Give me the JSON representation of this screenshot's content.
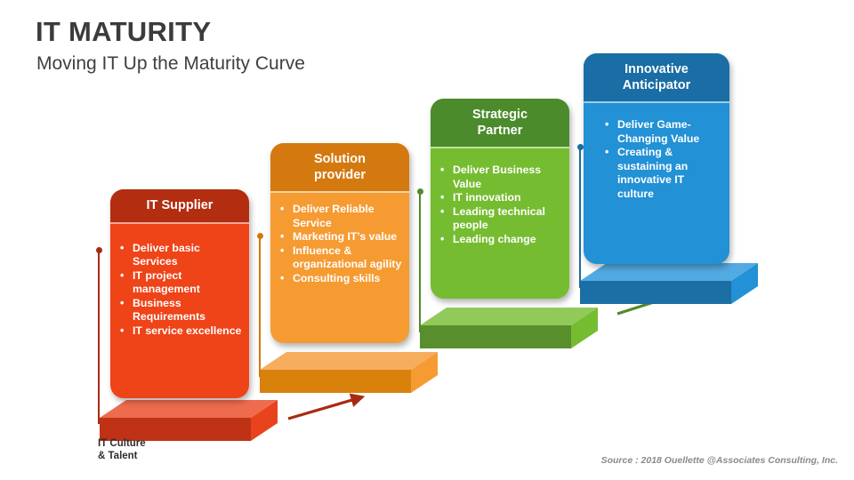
{
  "header": {
    "title": "IT MATURITY",
    "subtitle": "Moving IT Up the Maturity Curve"
  },
  "footer": {
    "source": "Source : 2018 Ouellette @Associates Consulting, Inc."
  },
  "base": {
    "label": "IT Culture\n& Talent"
  },
  "colors": {
    "title_text": "#3b3b3b",
    "source_text": "#8a8a8a",
    "red_header": "#b32d11",
    "red_body": "#ef4318",
    "red_slab_top": "#ef6b4e",
    "red_slab_front": "#bf3216",
    "red_slab_side": "#e8431d",
    "red_stem": "#a82a12",
    "orange_header": "#d4790f",
    "orange_body": "#f59b32",
    "orange_slab_top": "#f7ad5e",
    "orange_slab_front": "#d8820c",
    "orange_slab_side": "#f59b32",
    "orange_stem": "#cf7910",
    "green_header": "#4b8b2b",
    "green_body": "#76bc31",
    "green_slab_top": "#92c95b",
    "green_slab_front": "#588f2c",
    "green_slab_side": "#76bc31",
    "green_stem": "#4e8b2c",
    "blue_header": "#1a6ea5",
    "blue_body": "#2291d6",
    "blue_slab_top": "#52aae2",
    "blue_slab_front": "#1c6fa5",
    "blue_slab_side": "#2291d6",
    "blue_stem": "#1d6ea3"
  },
  "stages": [
    {
      "id": "it-supplier",
      "title": "IT Supplier",
      "bullets": [
        "Deliver basic Services",
        "IT project management",
        "Business Requirements",
        "IT service excellence"
      ]
    },
    {
      "id": "solution-provider",
      "title": "Solution\nprovider",
      "bullets": [
        "Deliver Reliable Service",
        "Marketing IT’s value",
        "Influence & organizational agility",
        "Consulting skills"
      ]
    },
    {
      "id": "strategic-partner",
      "title": "Strategic\nPartner",
      "bullets": [
        "Deliver Business Value",
        "IT innovation",
        "Leading technical people",
        "Leading change"
      ]
    },
    {
      "id": "innovative-anticipator",
      "title": "Innovative\nAnticipator",
      "bullets": [
        "Deliver Game-Changing Value",
        "Creating & sustaining an innovative IT culture"
      ]
    }
  ]
}
